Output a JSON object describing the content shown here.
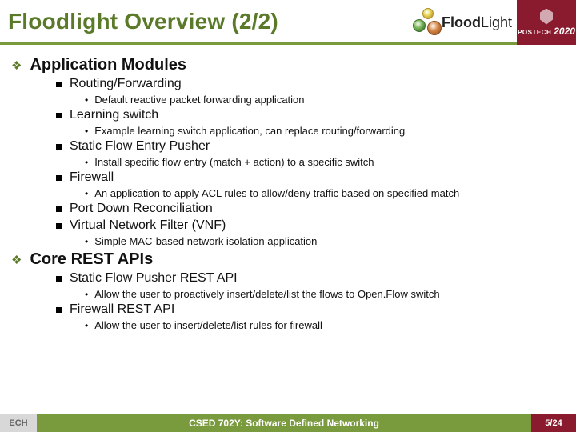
{
  "header": {
    "title": "Floodlight Overview (2/2)",
    "floodlight_logo_text_a": "Flood",
    "floodlight_logo_text_b": "Light",
    "postech_label": "POSTECH",
    "postech_year": "2020"
  },
  "sections": {
    "s0": {
      "title": "Application Modules",
      "items": {
        "i0": {
          "title": "Routing/Forwarding",
          "sub0": "Default reactive packet forwarding application"
        },
        "i1": {
          "title": "Learning switch",
          "sub0": "Example learning switch application, can replace routing/forwarding"
        },
        "i2": {
          "title": "Static Flow Entry Pusher",
          "sub0": "Install specific flow entry (match + action) to a specific switch"
        },
        "i3": {
          "title": "Firewall",
          "sub0": "An application to apply ACL rules to allow/deny traffic based on specified match"
        },
        "i4": {
          "title": "Port Down Reconciliation"
        },
        "i5": {
          "title": "Virtual Network Filter (VNF)",
          "sub0": "Simple MAC-based network isolation application"
        }
      }
    },
    "s1": {
      "title": "Core REST APIs",
      "items": {
        "i0": {
          "title": "Static Flow Pusher REST API",
          "sub0": "Allow the user to proactively insert/delete/list the flows to Open.Flow switch"
        },
        "i1": {
          "title": "Firewall REST API",
          "sub0": "Allow the user to insert/delete/list rules for firewall"
        }
      }
    }
  },
  "footer": {
    "left": "ECH",
    "mid": "CSED 702Y: Software Defined Networking",
    "right": "5/24"
  }
}
